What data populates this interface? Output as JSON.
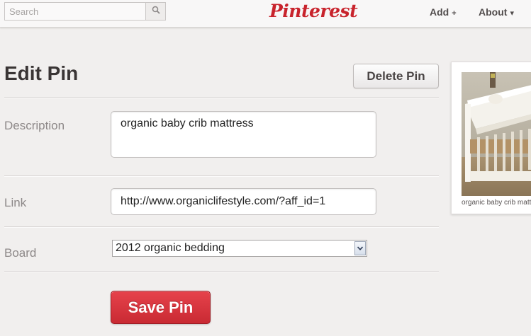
{
  "header": {
    "search": {
      "placeholder": "Search",
      "icon": "search-icon"
    },
    "logo": "Pinterest",
    "nav": {
      "add_label": "Add",
      "add_glyph": "+",
      "about_label": "About",
      "about_glyph": "▾"
    }
  },
  "page": {
    "title": "Edit Pin",
    "delete_label": "Delete Pin"
  },
  "form": {
    "description_label": "Description",
    "description_value": "organic baby crib mattress",
    "link_label": "Link",
    "link_value": "http://www.organiclifestyle.com/?aff_id=1",
    "board_label": "Board",
    "board_value": "2012 organic bedding",
    "save_label": "Save Pin"
  },
  "preview": {
    "caption": "organic baby crib mattress"
  },
  "colors": {
    "brand_red": "#c8232c",
    "save_button": "#d8343d",
    "background": "#f1efee"
  }
}
